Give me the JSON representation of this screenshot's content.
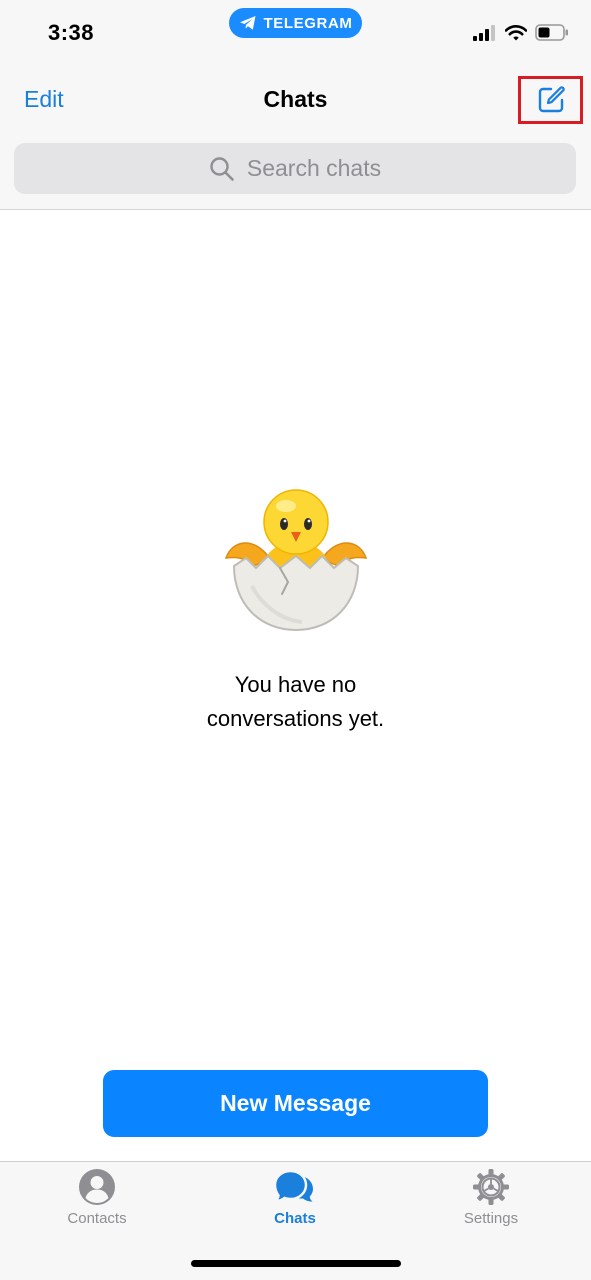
{
  "status_bar": {
    "time": "3:38",
    "app_pill_label": "TELEGRAM",
    "icons": [
      "signal-icon",
      "wifi-icon",
      "battery-icon"
    ]
  },
  "nav": {
    "edit_label": "Edit",
    "title": "Chats",
    "compose_icon": "compose-icon"
  },
  "search": {
    "placeholder": "Search chats",
    "icon": "search-icon"
  },
  "empty_state": {
    "illustration": "hatching-chick-icon",
    "line1": "You have no",
    "line2": "conversations yet."
  },
  "new_message_button": {
    "label": "New Message"
  },
  "tabs": [
    {
      "label": "Contacts",
      "icon": "contacts-icon",
      "active": false
    },
    {
      "label": "Chats",
      "icon": "chats-icon",
      "active": true
    },
    {
      "label": "Settings",
      "icon": "settings-icon",
      "active": false
    }
  ],
  "colors": {
    "accent": "#1b7fdc",
    "button_blue": "#0a84ff",
    "highlight_box": "#d91c24",
    "inactive_gray": "#8e8e93"
  }
}
